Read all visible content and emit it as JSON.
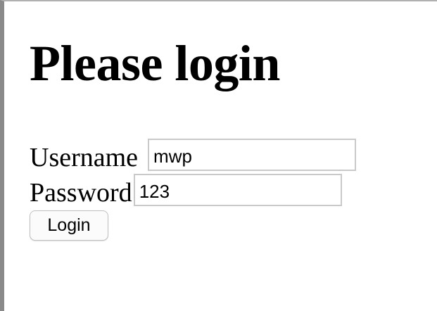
{
  "page": {
    "title": "Please login"
  },
  "form": {
    "username_label": "Username",
    "username_value": "mwp",
    "password_label": "Password",
    "password_value": "123",
    "login_button_label": "Login"
  }
}
